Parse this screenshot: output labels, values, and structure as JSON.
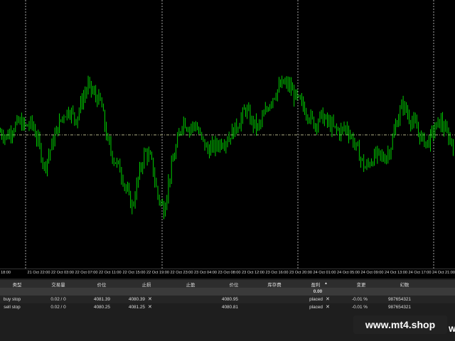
{
  "chart": {
    "symbol_label": "",
    "colors": {
      "background": "#000000",
      "candle": "#00ff00",
      "grid": "#cccccc",
      "price_line": "#8a8a6a"
    },
    "current_price": 4080.95,
    "price_range": [
      4070.0,
      4092.0
    ],
    "closes": [
      4081.2,
      4080.8,
      4081.5,
      4082.0,
      4081.6,
      4081.9,
      4080.4,
      4078.3,
      4079.8,
      4081.4,
      4082.6,
      4083.0,
      4082.2,
      4083.8,
      4085.0,
      4084.2,
      4083.6,
      4080.5,
      4079.0,
      4078.2,
      4076.5,
      4075.0,
      4077.6,
      4079.6,
      4078.9,
      4076.0,
      4074.8,
      4077.8,
      4080.0,
      4082.2,
      4081.5,
      4081.8,
      4080.6,
      4079.7,
      4080.0,
      4080.3,
      4080.6,
      4081.2,
      4082.0,
      4083.1,
      4082.0,
      4081.5,
      4082.6,
      4083.8,
      4084.6,
      4085.2,
      4084.9,
      4084.0,
      4083.4,
      4082.6,
      4081.8,
      4082.5,
      4082.0,
      4081.5,
      4081.2,
      4081.6,
      4080.6,
      4079.4,
      4078.2,
      4078.9,
      4079.3,
      4079.0,
      4079.8,
      4082.0,
      4083.5,
      4082.4,
      4081.7,
      4080.6,
      4080.3,
      4081.4,
      4082.1,
      4081.0,
      4080.2
    ],
    "time_labels": [
      "18:00",
      "21 Oct 22:00",
      "22 Oct 03:00",
      "22 Oct 07:00",
      "22 Oct 11:00",
      "22 Oct 15:00",
      "22 Oct 19:00",
      "22 Oct 23:00",
      "23 Oct 04:00",
      "23 Oct 08:00",
      "23 Oct 12:00",
      "23 Oct 16:00",
      "23 Oct 20:00",
      "24 Oct 01:00",
      "24 Oct 05:00",
      "24 Oct 09:00",
      "24 Oct 13:00",
      "24 Oct 17:00",
      "24 Oct 21:00",
      "27 Oct 02"
    ]
  },
  "terminal": {
    "headers": {
      "type": "类型",
      "volume": "交易量",
      "price": "价位",
      "sl": "止损",
      "tp": "止盈",
      "cur_price": "价位",
      "swap": "库存费",
      "profit": "盈利",
      "change": "变更",
      "comment": "幻数"
    },
    "total_profit": "0.00",
    "rows": [
      {
        "type": "buy stop",
        "volume": "0.02 / 0",
        "price": "4081.39",
        "sl": "4080.39",
        "tp": "",
        "cur_price": "4080.95",
        "status": "placed",
        "change": "-0.01 %",
        "magic": "987654321"
      },
      {
        "type": "sell stop",
        "volume": "0.02 / 0",
        "price": "4080.25",
        "sl": "4081.25",
        "tp": "",
        "cur_price": "4080.81",
        "status": "placed",
        "change": "-0.01 %",
        "magic": "987654321"
      }
    ],
    "close_glyph": "✕",
    "sort_glyph": "▲"
  },
  "watermark": {
    "text": "www.mt4.shop",
    "edge_char": "W"
  }
}
